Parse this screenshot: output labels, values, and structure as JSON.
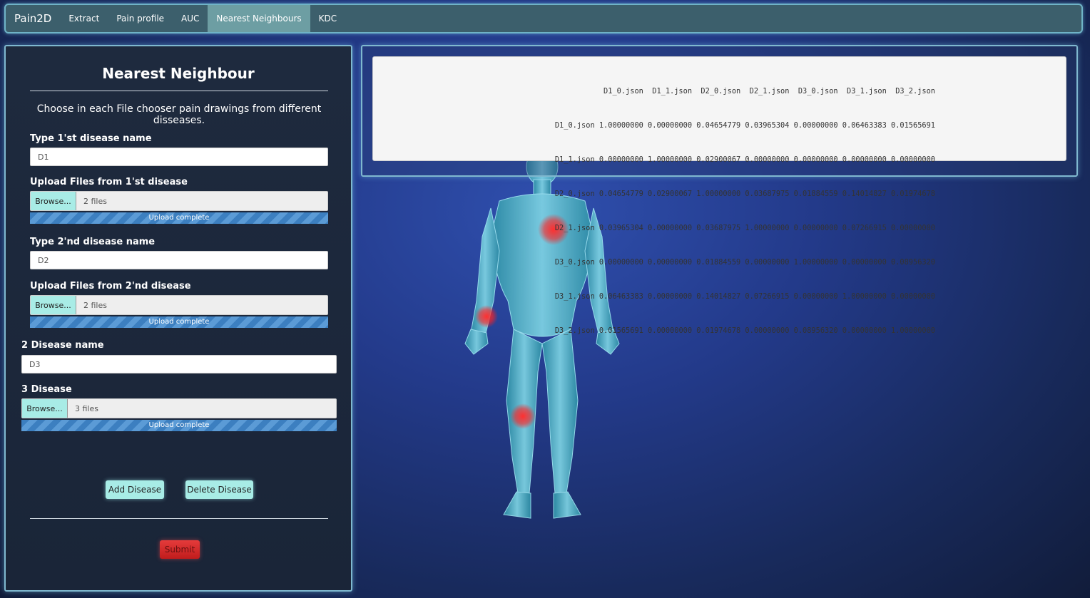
{
  "navbar": {
    "brand": "Pain2D",
    "tabs": [
      {
        "label": "Extract"
      },
      {
        "label": "Pain profile"
      },
      {
        "label": "AUC"
      },
      {
        "label": "Nearest Neighbours"
      },
      {
        "label": "KDC"
      }
    ],
    "active_tab": "Nearest Neighbours"
  },
  "form": {
    "title": "Nearest Neighbour",
    "description": "Choose in each File chooser pain drawings from different disseases.",
    "disease1": {
      "name_label": "Type 1'st disease name",
      "name_value": "D1",
      "upload_label": "Upload Files from 1'st disease",
      "browse_label": "Browse...",
      "files_text": "2 files",
      "progress_text": "Upload complete"
    },
    "disease2": {
      "name_label": "Type 2'nd disease name",
      "name_value": "D2",
      "upload_label": "Upload Files from 2'nd disease",
      "browse_label": "Browse...",
      "files_text": "2 files",
      "progress_text": "Upload complete"
    },
    "disease3": {
      "name_label": "2 Disease name",
      "name_value": "D3",
      "upload_label": "3 Disease",
      "browse_label": "Browse...",
      "files_text": "3 files",
      "progress_text": "Upload complete"
    },
    "add_button": "Add Disease",
    "delete_button": "Delete Disease",
    "submit_button": "Submit"
  },
  "output": {
    "header": "        D1_0.json  D1_1.json  D2_0.json  D2_1.json  D3_0.json  D3_1.json  D3_2.json",
    "rows": [
      "D1_0.json 1.00000000 0.00000000 0.04654779 0.03965304 0.00000000 0.06463383 0.01565691",
      "D1_1.json 0.00000000 1.00000000 0.02900067 0.00000000 0.00000000 0.00000000 0.00000000",
      "D2_0.json 0.04654779 0.02900067 1.00000000 0.03687975 0.01884559 0.14014827 0.01974678",
      "D2_1.json 0.03965304 0.00000000 0.03687975 1.00000000 0.00000000 0.07266915 0.00000000",
      "D3_0.json 0.00000000 0.00000000 0.01884559 0.00000000 1.00000000 0.00000000 0.08956320",
      "D3_1.json 0.06463383 0.00000000 0.14014827 0.07266915 0.00000000 1.00000000 0.00000000",
      "D3_2.json 0.01565691 0.00000000 0.01974678 0.00000000 0.08956320 0.00000000 1.00000000"
    ]
  },
  "colors": {
    "navbar_bg": "#3c5f6c",
    "accent_button": "#a8ece6",
    "submit": "#d42a2a",
    "progress": "#3c7fc0",
    "pain_marker": "#ff2020"
  }
}
